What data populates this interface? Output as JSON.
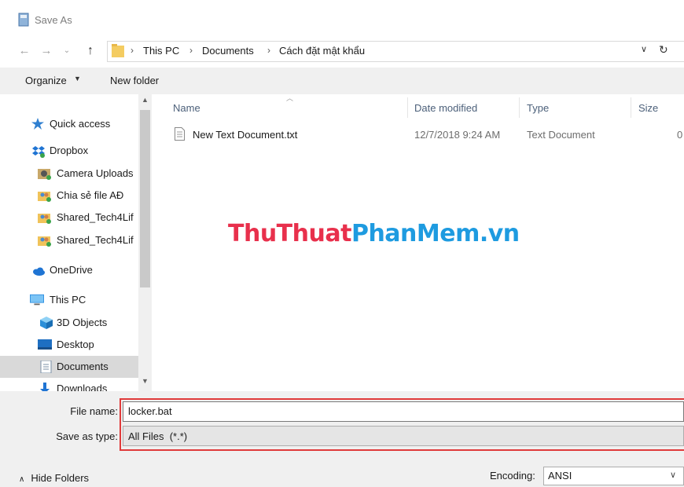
{
  "window": {
    "title": "Save As"
  },
  "nav": {
    "back": "←",
    "forward": "→",
    "recent": "⌄",
    "up": "↑"
  },
  "address": {
    "crumbs": [
      "This PC",
      "Documents",
      "Cách đặt mật khẩu"
    ],
    "separator": "›",
    "dropdown": "∨",
    "refresh": "↻"
  },
  "toolbar": {
    "organize": "Organize",
    "new_folder": "New folder"
  },
  "sidebar": {
    "items": [
      {
        "label": "Quick access",
        "icon": "star-icon"
      },
      {
        "label": "Dropbox",
        "icon": "dropbox-icon"
      },
      {
        "label": "Camera Uploads",
        "icon": "camera-uploads-folder-icon"
      },
      {
        "label": "Chia sẻ file AĐ",
        "icon": "shared-folder-icon"
      },
      {
        "label": "Shared_Tech4Lif",
        "icon": "shared-folder-icon"
      },
      {
        "label": "Shared_Tech4Lif",
        "icon": "shared-folder-icon"
      },
      {
        "label": "OneDrive",
        "icon": "onedrive-cloud-icon"
      },
      {
        "label": "This PC",
        "icon": "computer-icon"
      },
      {
        "label": "3D Objects",
        "icon": "3d-objects-icon"
      },
      {
        "label": "Desktop",
        "icon": "desktop-icon"
      },
      {
        "label": "Documents",
        "icon": "documents-icon"
      },
      {
        "label": "Downloads",
        "icon": "downloads-icon"
      }
    ]
  },
  "filelist": {
    "columns": [
      "Name",
      "Date modified",
      "Type",
      "Size"
    ],
    "rows": [
      {
        "name": "New Text Document.txt",
        "date": "12/7/2018 9:24 AM",
        "type": "Text Document",
        "size": "0"
      }
    ]
  },
  "watermark": {
    "part1": "ThuThuat",
    "part2": "PhanMem",
    "part3": ".vn"
  },
  "form": {
    "file_name_label": "File name:",
    "file_name_value": "locker.bat",
    "save_type_label": "Save as type:",
    "save_type_value": "All Files  (*.*)"
  },
  "footer": {
    "hide_folders": "Hide Folders",
    "encoding_label": "Encoding:",
    "encoding_value": "ANSI"
  },
  "colors": {
    "highlight": "#e03a3a",
    "watermark_red": "#e8304c",
    "watermark_blue": "#1e9be0",
    "selected": "#d9d9d9"
  }
}
